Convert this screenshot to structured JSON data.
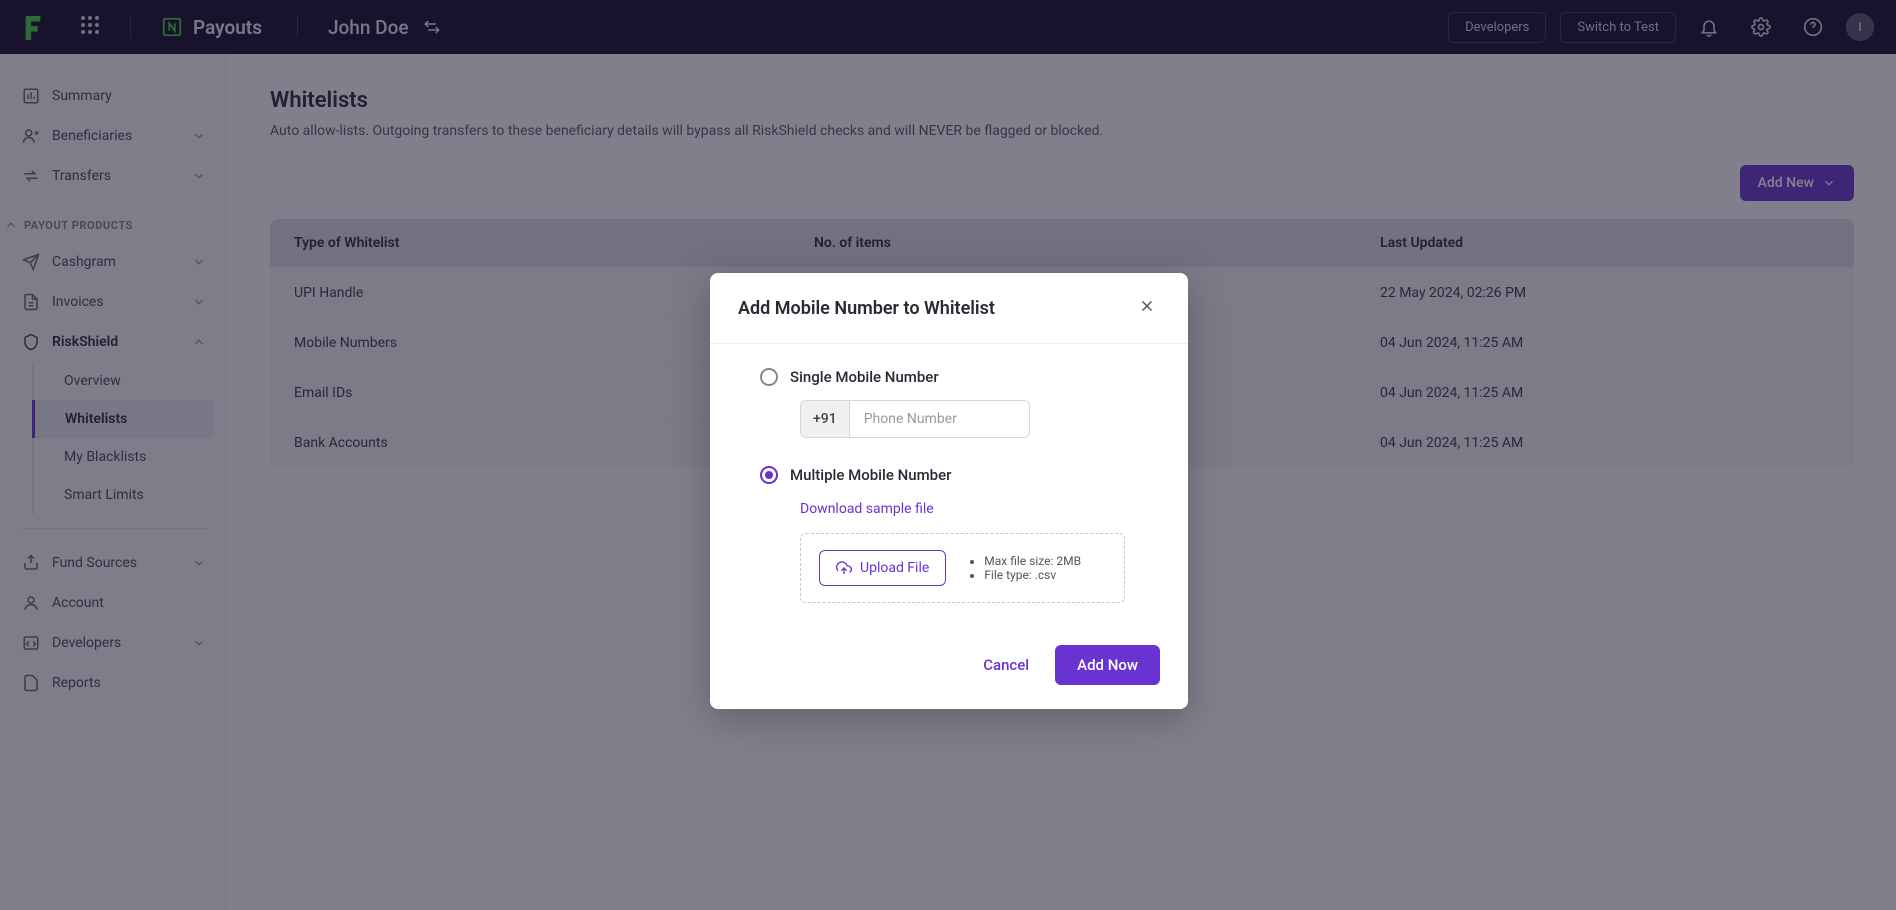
{
  "header": {
    "product_name": "Payouts",
    "user_name": "John Doe",
    "developers_btn": "Developers",
    "switch_btn": "Switch to Test",
    "avatar_letter": "I"
  },
  "sidebar": {
    "summary": "Summary",
    "beneficiaries": "Beneficiaries",
    "transfers": "Transfers",
    "section_payout_products": "PAYOUT PRODUCTS",
    "cashgram": "Cashgram",
    "invoices": "Invoices",
    "riskshield": "RiskShield",
    "rs_overview": "Overview",
    "rs_whitelists": "Whitelists",
    "rs_blacklists": "My Blacklists",
    "rs_smartlimits": "Smart Limits",
    "fund_sources": "Fund Sources",
    "account": "Account",
    "developers": "Developers",
    "reports": "Reports"
  },
  "page": {
    "title": "Whitelists",
    "description": "Auto allow-lists. Outgoing transfers to these beneficiary details will bypass all RiskShield checks and will NEVER be flagged or blocked.",
    "add_new_btn": "Add New"
  },
  "table": {
    "col_type": "Type of Whitelist",
    "col_count": "No. of items",
    "col_updated": "Last Updated",
    "rows": [
      {
        "type": "UPI Handle",
        "updated": "22 May 2024, 02:26 PM"
      },
      {
        "type": "Mobile Numbers",
        "updated": "04 Jun 2024, 11:25 AM"
      },
      {
        "type": "Email IDs",
        "updated": "04 Jun 2024, 11:25 AM"
      },
      {
        "type": "Bank Accounts",
        "updated": "04 Jun 2024, 11:25 AM"
      }
    ]
  },
  "modal": {
    "title": "Add Mobile Number to Whitelist",
    "single_label": "Single Mobile Number",
    "phone_prefix": "+91",
    "phone_placeholder": "Phone Number",
    "multiple_label": "Multiple Mobile Number",
    "sample_link": "Download sample file",
    "upload_btn": "Upload File",
    "hint_size": "Max file size: 2MB",
    "hint_type": "File type: .csv",
    "cancel": "Cancel",
    "confirm": "Add Now"
  }
}
